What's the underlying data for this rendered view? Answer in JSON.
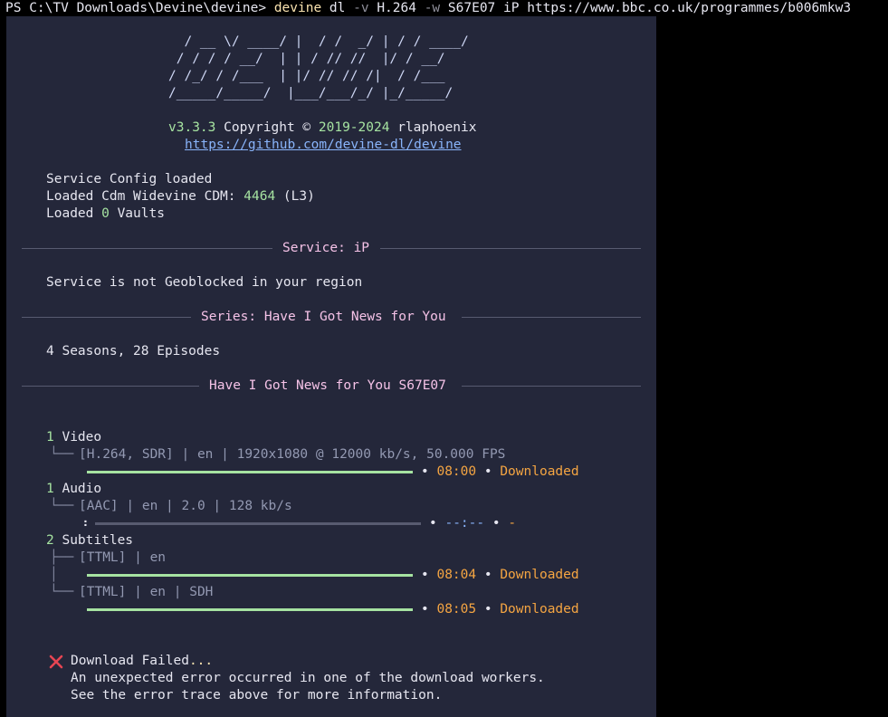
{
  "command": {
    "prompt": "PS C:\\TV Downloads\\Devine\\devine> ",
    "exe": "devine",
    "arg1": " dl ",
    "flag_v": "-v",
    "val_v": " H.264 ",
    "flag_w": "-w",
    "val_w": " S67E07 iP https://www.bbc.co.uk/programmes/b006mkw3"
  },
  "logo": {
    "line1": "  / __ \\/ ____/ |  / /  _/ | / / ____/",
    "line2": " / / / / __/  | | / // //  |/ / __/   ",
    "line3": "/ /_/ / /___  | |/ // // /|  / /___   ",
    "line4": "/_____/_____/  |___/___/_/ |_/_____/   "
  },
  "header": {
    "version": "v3.3.3",
    "copyright_prefix": " Copyright © ",
    "years": "2019-2024",
    "author": " rlaphoenix",
    "link": "https://github.com/devine-dl/devine"
  },
  "log": {
    "line1": "Service Config loaded",
    "line2_prefix": "Loaded Cdm Widevine CDM: ",
    "cdm_id": "4464",
    "cdm_suffix": " (L3)",
    "line3_prefix": "Loaded ",
    "vault_count": "0",
    "line3_suffix": " Vaults"
  },
  "sections": {
    "service_title": "Service: iP",
    "geo_text": "Service is not Geoblocked in your region",
    "series_title": "Series: Have I Got News for You",
    "seasons_text": "4 Seasons, 28 Episodes",
    "episode_title": "Have I Got News for You S67E07"
  },
  "tracks": {
    "video_count": "1",
    "video_label": " Video",
    "video_desc": "[H.264, SDR] | en | 1920x1080 @ 12000 kb/s, 50.000 FPS",
    "video_time": "08:00",
    "video_status": "Downloaded",
    "video_progress": 1.0,
    "audio_count": "1",
    "audio_label": " Audio",
    "audio_desc": "[AAC] | en | 2.0 | 128 kb/s",
    "audio_spinner": "⠰",
    "audio_time": "--:--",
    "audio_status": "-",
    "audio_progress": 0.0,
    "subs_count": "2",
    "subs_label": " Subtitles",
    "sub1_desc": "[TTML] | en",
    "sub1_time": "08:04",
    "sub1_status": "Downloaded",
    "sub1_progress": 1.0,
    "sub2_desc": "[TTML] | en | SDH",
    "sub2_time": "08:05",
    "sub2_status": "Downloaded",
    "sub2_progress": 1.0,
    "bullet": "•"
  },
  "error": {
    "icon": "cross-icon",
    "title": "Download Failed",
    "ellipsis": "...",
    "line1": "An unexpected error occurred in one of the download workers.",
    "line2": "See the error trace above for more information."
  }
}
